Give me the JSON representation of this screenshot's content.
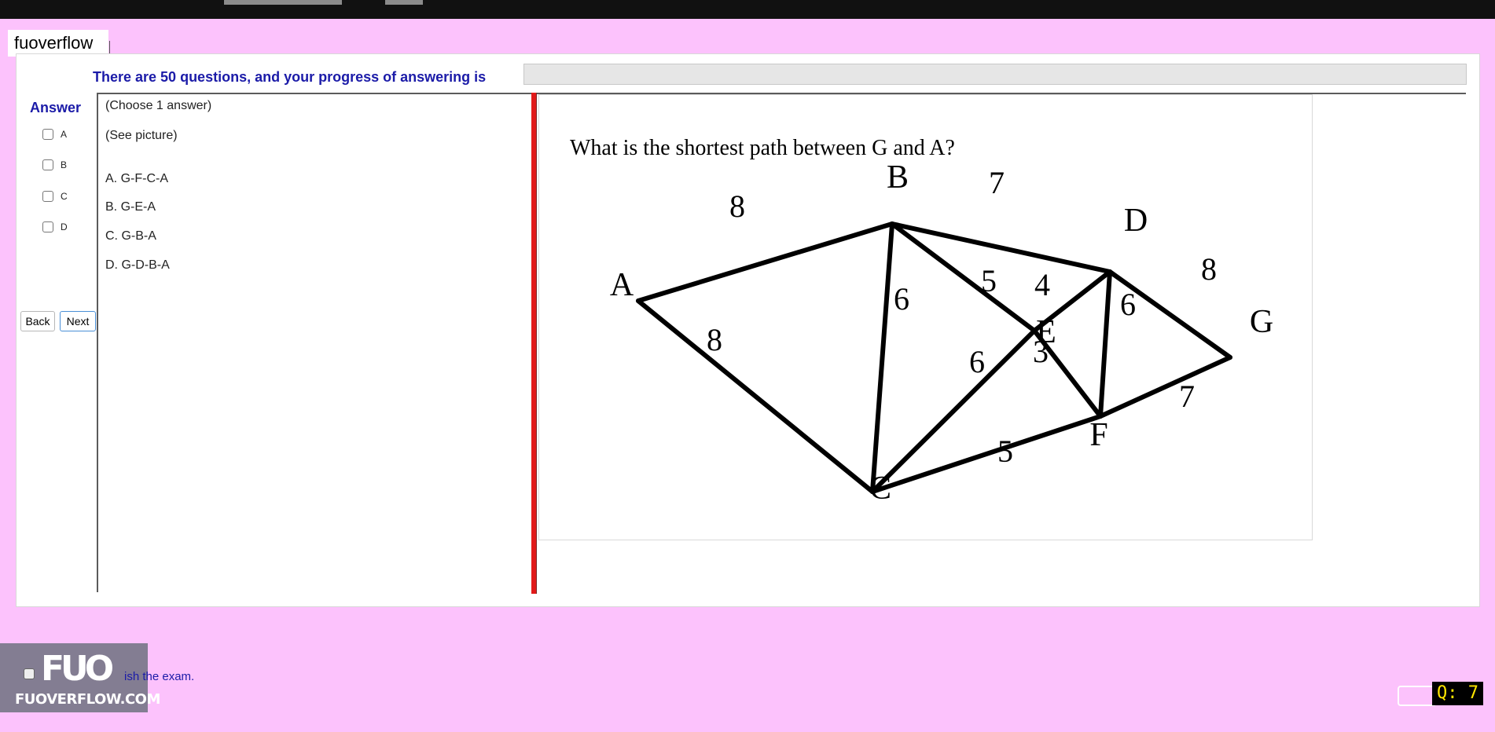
{
  "app": {
    "brand": "fuoverflow"
  },
  "progress": {
    "label": "There are 50 questions, and your progress of answering is",
    "fraction": 0
  },
  "answer": {
    "heading": "Answer",
    "options": [
      {
        "label": "A",
        "checked": false
      },
      {
        "label": "B",
        "checked": false
      },
      {
        "label": "C",
        "checked": false
      },
      {
        "label": "D",
        "checked": false
      }
    ]
  },
  "nav": {
    "back_label": "Back",
    "next_label": "Next"
  },
  "question": {
    "instruction": "(Choose 1 answer)",
    "see_picture": "(See picture)",
    "choices": [
      "A.  G-F-C-A",
      "B.  G-E-A",
      "C.  G-B-A",
      "D.  G-D-B-A"
    ]
  },
  "figure": {
    "question_text": "What is the shortest path between G and A?",
    "nodes": [
      {
        "id": "A",
        "label": "A"
      },
      {
        "id": "B",
        "label": "B"
      },
      {
        "id": "C",
        "label": "C"
      },
      {
        "id": "D",
        "label": "D"
      },
      {
        "id": "E",
        "label": "E"
      },
      {
        "id": "F",
        "label": "F"
      },
      {
        "id": "G",
        "label": "G"
      }
    ],
    "edges": [
      {
        "from": "A",
        "to": "B",
        "weight": "8"
      },
      {
        "from": "A",
        "to": "C",
        "weight": "8"
      },
      {
        "from": "B",
        "to": "D",
        "weight": "7"
      },
      {
        "from": "B",
        "to": "C",
        "weight": "6"
      },
      {
        "from": "B",
        "to": "E",
        "weight": "5"
      },
      {
        "from": "E",
        "to": "F",
        "weight": "3"
      },
      {
        "from": "D",
        "to": "E",
        "weight": "4"
      },
      {
        "from": "C",
        "to": "E",
        "weight": "6"
      },
      {
        "from": "D",
        "to": "F",
        "weight": "6"
      },
      {
        "from": "D",
        "to": "G",
        "weight": "8"
      },
      {
        "from": "F",
        "to": "G",
        "weight": "7"
      },
      {
        "from": "C",
        "to": "F",
        "weight": "5"
      }
    ]
  },
  "footer": {
    "finish_text": "ish the exam.",
    "watermark_logo": "FUO",
    "watermark_url": "FUOVERFLOW.COM",
    "question_badge": "Q: 7"
  },
  "colors": {
    "page_bg": "#fcc2fc",
    "heading_blue": "#1b1ba8",
    "divider_red": "#e11a1a",
    "badge_text": "#ffe600"
  }
}
